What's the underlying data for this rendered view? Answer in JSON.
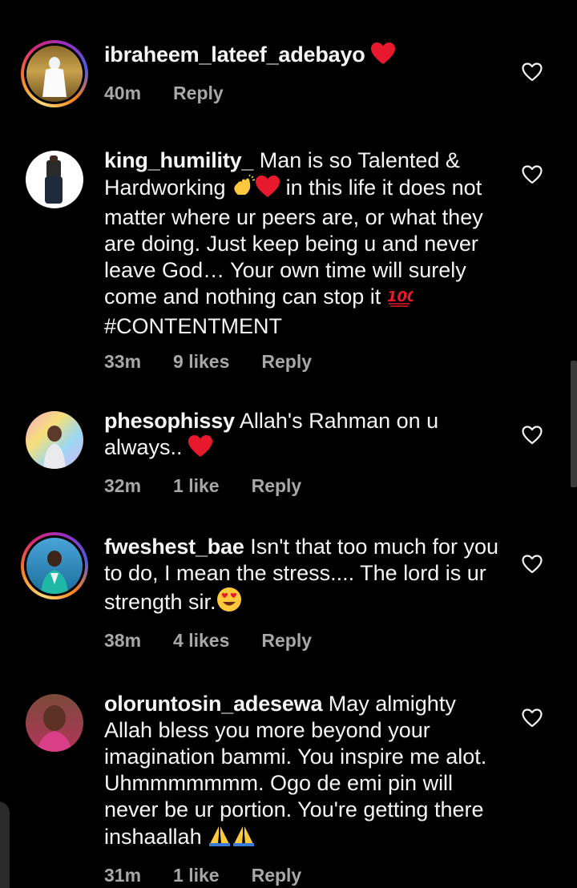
{
  "comments": [
    {
      "username": "ibraheem_lateef_adebayo",
      "text": "",
      "time": "40m",
      "likes": "",
      "reply_label": "Reply"
    },
    {
      "username": "king_humility_",
      "text_a": " Man is so Talented & Hardworking ",
      "text_b": " in this life it does not matter where ur peers are, or what they are doing. Just keep being u and never leave God… Your own time will surely come and nothing can stop it ",
      "text_c": "#CONTENTMENT",
      "time": "33m",
      "likes": "9 likes",
      "reply_label": "Reply"
    },
    {
      "username": "phesophissy",
      "text_a": " Allah's Rahman on u always.. ",
      "time": "32m",
      "likes": "1 like",
      "reply_label": "Reply"
    },
    {
      "username": "fweshest_bae",
      "text_a": " Isn't that too much for you to do, I mean the stress.... The lord is ur strength sir.",
      "time": "38m",
      "likes": "4 likes",
      "reply_label": "Reply"
    },
    {
      "username": "oloruntosin_adesewa",
      "text_a": " May almighty Allah bless you more beyond your imagination bammi.  You inspire me alot. Uhmmmmmmm. Ogo de emi pin will never be ur portion. You're getting there inshaallah ",
      "time": "31m",
      "likes": "1 like",
      "reply_label": "Reply"
    }
  ],
  "icons": {
    "like": "heart-outline-icon",
    "red_heart": "red-heart-emoji",
    "clap": "waving-hand-emoji",
    "hundred": "hundred-points-emoji",
    "heart_eyes": "heart-eyes-emoji",
    "pray": "folded-hands-emoji"
  },
  "colors": {
    "background": "#000000",
    "text": "#f5f5f5",
    "meta": "#a8a8a8",
    "heart": "#e8192c"
  }
}
